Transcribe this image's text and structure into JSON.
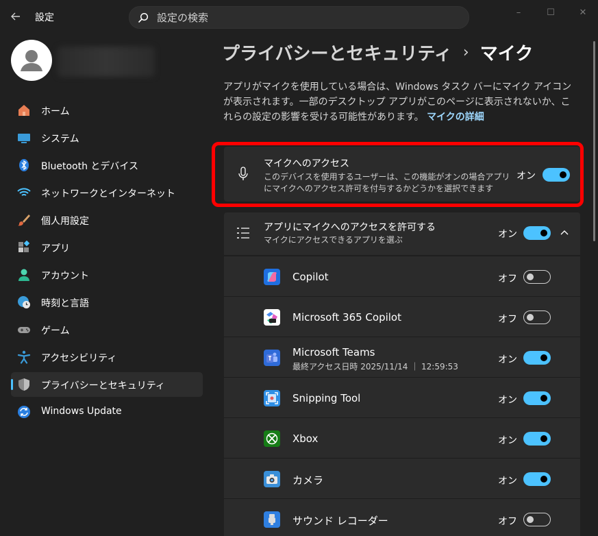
{
  "window": {
    "title": "設定",
    "controls": {
      "minimize": "–",
      "maximize": "☐",
      "close": "✕"
    }
  },
  "search": {
    "placeholder": "設定の検索"
  },
  "sidebar": {
    "items": [
      {
        "label": "ホーム",
        "icon": "home-icon"
      },
      {
        "label": "システム",
        "icon": "system-icon"
      },
      {
        "label": "Bluetooth とデバイス",
        "icon": "bluetooth-icon"
      },
      {
        "label": "ネットワークとインターネット",
        "icon": "wifi-icon"
      },
      {
        "label": "個人用設定",
        "icon": "brush-icon"
      },
      {
        "label": "アプリ",
        "icon": "apps-icon"
      },
      {
        "label": "アカウント",
        "icon": "account-icon"
      },
      {
        "label": "時刻と言語",
        "icon": "time-language-icon"
      },
      {
        "label": "ゲーム",
        "icon": "gamepad-icon"
      },
      {
        "label": "アクセシビリティ",
        "icon": "accessibility-icon"
      },
      {
        "label": "プライバシーとセキュリティ",
        "icon": "shield-icon",
        "active": true
      },
      {
        "label": "Windows Update",
        "icon": "update-icon"
      }
    ]
  },
  "main": {
    "breadcrumb": {
      "parent": "プライバシーとセキュリティ",
      "separator": "›",
      "current": "マイク"
    },
    "description": "アプリがマイクを使用している場合は、Windows タスク バーにマイク アイコンが表示されます。一部のデスクトップ アプリがこのページに表示されないか、これらの設定の影響を受ける可能性があります。",
    "description_link": "マイクの詳細",
    "access_card": {
      "title": "マイクへのアクセス",
      "subtitle_line1": "このデバイスを使用するユーザーは、この機能がオンの場合アプリ",
      "subtitle_line2": "にマイクへのアクセス許可を付与するかどうかを選択できます",
      "state": "オン",
      "on": true
    },
    "apps_header": {
      "title": "アプリにマイクへのアクセスを許可する",
      "subtitle": "マイクにアクセスできるアプリを選ぶ",
      "state": "オン",
      "on": true
    },
    "apps": [
      {
        "name": "Copilot",
        "sub": "",
        "state": "オフ",
        "on": false,
        "icon": "copilot-icon"
      },
      {
        "name": "Microsoft 365 Copilot",
        "sub": "",
        "state": "オフ",
        "on": false,
        "icon": "m365-copilot-icon"
      },
      {
        "name": "Microsoft Teams",
        "sub": "最終アクセス日時 2025/11/14 ｜ 12:59:53",
        "state": "オン",
        "on": true,
        "icon": "teams-icon"
      },
      {
        "name": "Snipping Tool",
        "sub": "",
        "state": "オン",
        "on": true,
        "icon": "snipping-tool-icon"
      },
      {
        "name": "Xbox",
        "sub": "",
        "state": "オン",
        "on": true,
        "icon": "xbox-icon"
      },
      {
        "name": "カメラ",
        "sub": "",
        "state": "オン",
        "on": true,
        "icon": "camera-icon"
      },
      {
        "name": "サウンド レコーダー",
        "sub": "",
        "state": "オフ",
        "on": false,
        "icon": "sound-recorder-icon"
      }
    ]
  },
  "colors": {
    "accent": "#4cc2ff",
    "highlight": "#ff0000",
    "background": "#202020",
    "card": "#2b2b2b"
  }
}
